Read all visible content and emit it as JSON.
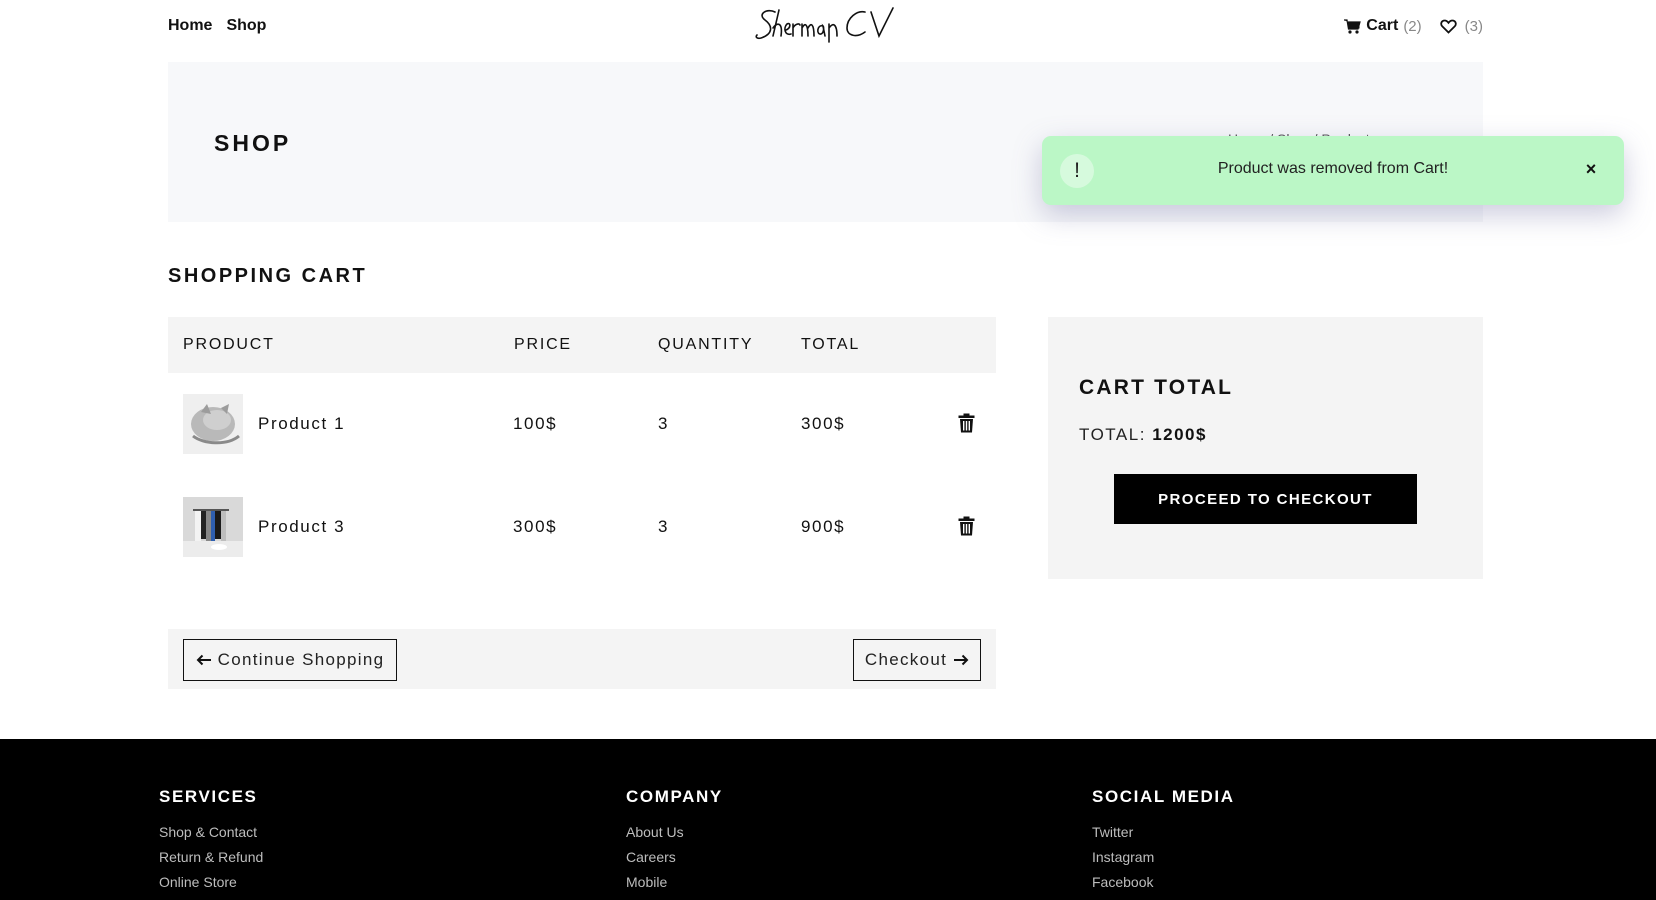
{
  "nav": {
    "links": [
      {
        "label": "Home"
      },
      {
        "label": "Shop"
      }
    ],
    "logo_text": "Sherman CV",
    "cart": {
      "label": "Cart",
      "count": "(2)",
      "icon": "cart-icon"
    },
    "wishlist": {
      "count": "(3)",
      "icon": "heart-icon"
    }
  },
  "hero": {
    "title": "SHOP",
    "breadcrumb": "Home / Shop / Products"
  },
  "cart": {
    "title": "SHOPPING CART",
    "columns": [
      "PRODUCT",
      "PRICE",
      "QUANTITY",
      "TOTAL"
    ],
    "rows": [
      {
        "name": "Product 1",
        "price": "100$",
        "quantity": "3",
        "total": "300$",
        "image": "cat-photo"
      },
      {
        "name": "Product 3",
        "price": "300$",
        "quantity": "3",
        "total": "900$",
        "image": "clothes-rack-photo"
      }
    ],
    "continue_label": "Continue Shopping",
    "checkout_label": "Checkout"
  },
  "summary": {
    "title": "CART TOTAL",
    "total_label": "TOTAL:",
    "total_value": "1200$",
    "proceed_label": "PROCEED TO CHECKOUT"
  },
  "footer": {
    "columns": [
      {
        "title": "SERVICES",
        "links": [
          "Shop & Contact",
          "Return & Refund",
          "Online Store"
        ]
      },
      {
        "title": "COMPANY",
        "links": [
          "About Us",
          "Careers",
          "Mobile"
        ]
      },
      {
        "title": "SOCIAL MEDIA",
        "links": [
          "Twitter",
          "Instagram",
          "Facebook"
        ]
      }
    ]
  },
  "toast": {
    "icon": "!",
    "message": "Product was removed from Cart!",
    "close": "×",
    "color": "#bbf7c6"
  }
}
